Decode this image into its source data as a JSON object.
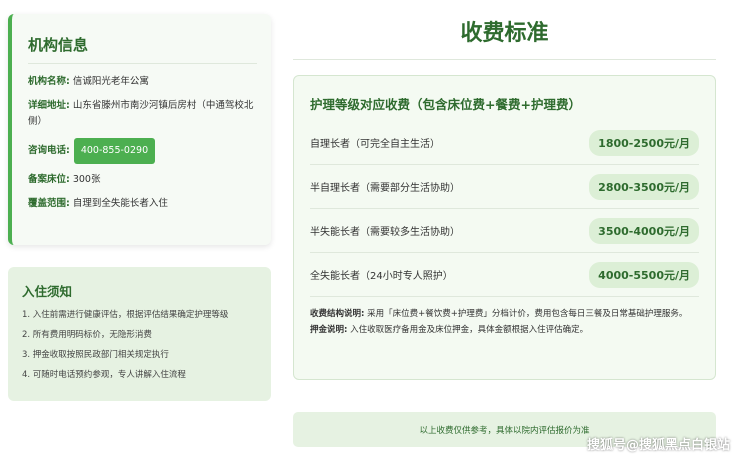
{
  "org": {
    "title": "机构信息",
    "name_key": "机构名称:",
    "name_value": "信诚阳光老年公寓",
    "address_key": "详细地址:",
    "address_value": "山东省滕州市南沙河镇后房村（中通驾校北侧）",
    "phone_key": "咨询电话:",
    "phone_value": "400-855-0290",
    "beds_key": "备案床位:",
    "beds_value": "300张",
    "scope_key": "覆盖范围:",
    "scope_value": "自理到全失能长者入住"
  },
  "notice": {
    "title": "入住须知",
    "items": [
      "1. 入住前需进行健康评估，根据评估结果确定护理等级",
      "2. 所有费用明码标价，无隐形消费",
      "3. 押金收取按照民政部门相关规定执行",
      "4. 可随时电话预约参观，专人讲解入住流程"
    ]
  },
  "page_title": "收费标准",
  "fees": {
    "heading": "护理等级对应收费（包含床位费+餐费+护理费）",
    "rows": [
      {
        "label": "自理长者（可完全自主生活）",
        "price": "1800-2500元/月"
      },
      {
        "label": "半自理长者（需要部分生活协助）",
        "price": "2800-3500元/月"
      },
      {
        "label": "半失能长者（需要较多生活协助）",
        "price": "3500-4000元/月"
      },
      {
        "label": "全失能长者（24小时专人照护）",
        "price": "4000-5500元/月"
      }
    ],
    "structure_key": "收费结构说明:",
    "structure_value": "采用「床位费+餐饮费+护理费」分档计价，费用包含每日三餐及日常基础护理服务。",
    "deposit_key": "押金说明:",
    "deposit_value": "入住收取医疗备用金及床位押金，具体金额根据入住评估确定。"
  },
  "footer_note": "以上收费仅供参考，具体以院内评估报价为准",
  "watermark": "搜狐号@搜狐黑点白银站",
  "colors": {
    "accent": "#4caf50",
    "title_green": "#2e6b2e",
    "panel_light": "#e6f2e2"
  }
}
